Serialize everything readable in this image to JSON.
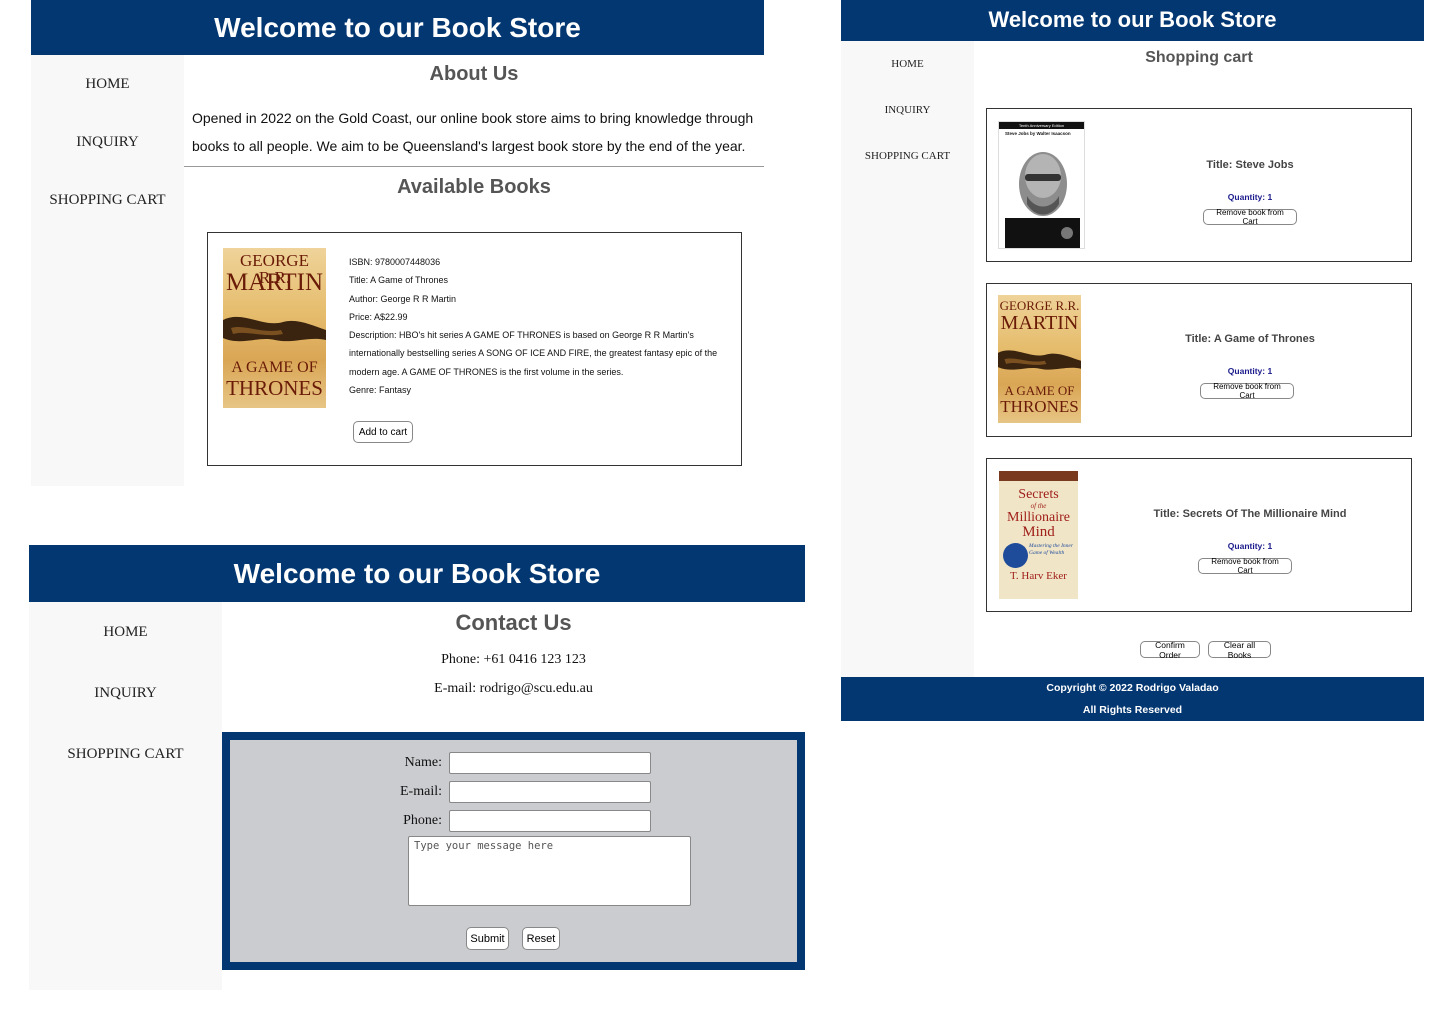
{
  "about_page": {
    "banner": "Welcome to our Book Store",
    "nav": [
      "HOME",
      "INQUIRY",
      "SHOPPING CART"
    ],
    "about_title": "About Us",
    "about_text": "Opened in 2022 on the Gold Coast, our online book store aims to bring knowledge through books to all people. We aim to be Queensland's largest book store by the end of the year.",
    "available_title": "Available Books",
    "book": {
      "isbn": "ISBN: 9780007448036",
      "title": "Title: A Game of Thrones",
      "author": "Author: George R R Martin",
      "price": "Price: A$22.99",
      "description": "Description: HBO's hit series A GAME OF THRONES is based on George R R Martin's internationally bestselling series A SONG OF ICE AND FIRE, the greatest fantasy epic of the modern age. A GAME OF THRONES is the first volume in the series.",
      "genre": "Genre: Fantasy",
      "add_button": "Add to cart",
      "cover": {
        "line1": "GEORGE R.R.",
        "line2": "MARTIN",
        "line3": "A GAME OF",
        "line4": "THRONES"
      }
    }
  },
  "contact_page": {
    "banner": "Welcome to our Book Store",
    "nav": [
      "HOME",
      "INQUIRY",
      "SHOPPING CART"
    ],
    "title": "Contact Us",
    "phone": "Phone: +61 0416 123 123",
    "email": "E-mail: rodrigo@scu.edu.au",
    "form": {
      "name_label": "Name:",
      "email_label": "E-mail:",
      "phone_label": "Phone:",
      "message_placeholder": "Type your message here",
      "submit": "Submit",
      "reset": "Reset"
    }
  },
  "cart_page": {
    "banner": "Welcome to our Book Store",
    "nav": [
      "HOME",
      "INQUIRY",
      "SHOPPING CART"
    ],
    "title": "Shopping cart",
    "items": [
      {
        "title": "Title: Steve Jobs",
        "quantity": "Quantity: 1",
        "remove": "Remove book from Cart",
        "cover": {
          "band": "Tenth Anniversary Edition",
          "author": "Steve Jobs by Walter Isaacson"
        }
      },
      {
        "title": "Title: A Game of Thrones",
        "quantity": "Quantity: 1",
        "remove": "Remove book from Cart",
        "cover": {
          "line1": "GEORGE R.R.",
          "line2": "MARTIN",
          "line3": "A GAME OF",
          "line4": "THRONES"
        }
      },
      {
        "title": "Title: Secrets Of The Millionaire Mind",
        "quantity": "Quantity: 1",
        "remove": "Remove book from Cart",
        "cover": {
          "line1": "Secrets",
          "line2": "of the",
          "line3": "Millionaire",
          "line4": "Mind",
          "subtitle": "Mastering the Inner Game of Wealth",
          "author": "T. Harv Eker"
        }
      }
    ],
    "confirm": "Confirm Order",
    "clear": "Clear all Books",
    "footer_line1": "Copyright © 2022 Rodrigo Valadao",
    "footer_line2": "All Rights Reserved"
  },
  "colors": {
    "banner": "#033772",
    "sidebar": "#f8f8f8",
    "form_background": "#cbccd0",
    "quantity": "#1a1a8c"
  }
}
